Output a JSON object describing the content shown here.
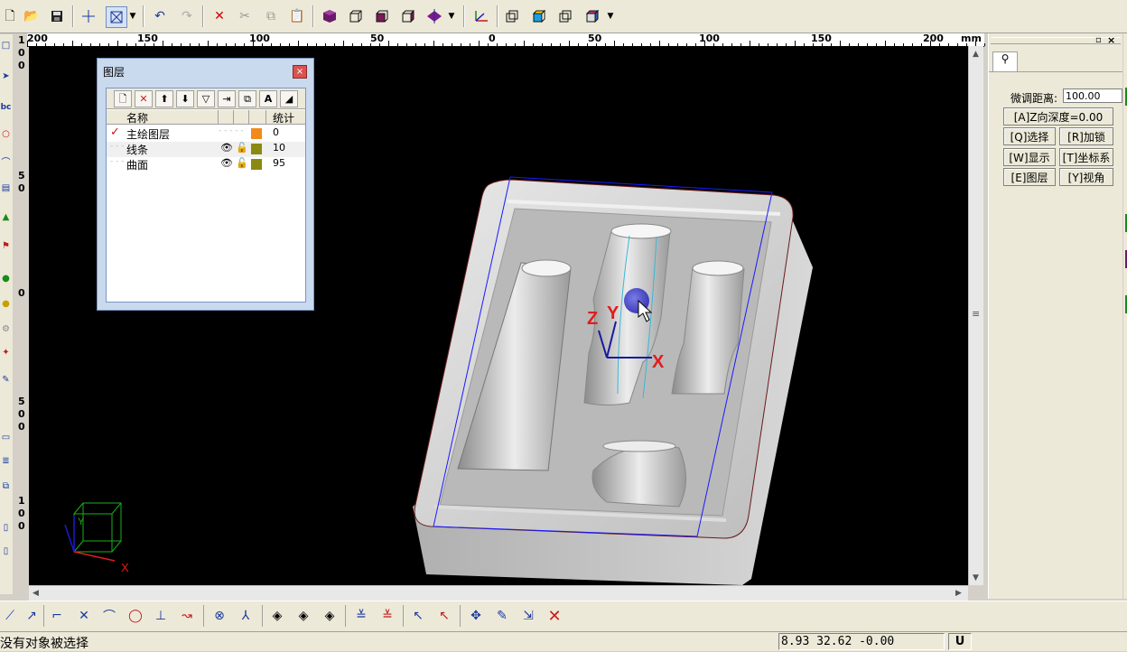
{
  "top_toolbar": {
    "icons": [
      "new-file-icon",
      "open-folder-icon",
      "save-icon",
      "crosshair-icon",
      "box-select-icon",
      "dropdown-arrow-icon",
      "undo-icon",
      "redo-icon",
      "delete-icon",
      "cut-icon",
      "copy-icon",
      "paste-icon",
      "shaded-cube-icon",
      "wire-cube-icon",
      "cube-front-icon",
      "cube-side-icon",
      "cube-iso-icon",
      "dropdown-arrow-icon",
      "axis-icon",
      "view-front-icon",
      "view-top-icon",
      "view-back-icon",
      "view-custom-icon",
      "dropdown-arrow-icon"
    ]
  },
  "ruler": {
    "labels": [
      "200",
      "150",
      "100",
      "50",
      "0",
      "50",
      "100",
      "150",
      "200"
    ],
    "unit": "mm"
  },
  "left_digits": [
    "1",
    "0",
    "0",
    "5",
    "0",
    "0",
    "5",
    "0",
    "0",
    "1",
    "0",
    "0"
  ],
  "layer_panel": {
    "title": "图层",
    "close_glyph": "×",
    "toolbar_icons": [
      "new-layer-icon",
      "delete-layer-icon",
      "move-up-icon",
      "move-down-icon",
      "filter-icon",
      "import-icon",
      "export-icon",
      "text-icon",
      "corner-icon"
    ],
    "col_name": "名称",
    "col_count": "统计",
    "rows": [
      {
        "name": "主绘图层",
        "count": "0",
        "color": "#f28a1a",
        "current": true
      },
      {
        "name": "线条",
        "count": "10",
        "color": "#8a8a12",
        "current": false
      },
      {
        "name": "曲面",
        "count": "95",
        "color": "#8a8a12",
        "current": false
      }
    ]
  },
  "viewport": {
    "axis_labels": {
      "z": "Z",
      "y": "Y",
      "x": "X"
    },
    "mini_axes": {
      "y": "Y",
      "x": "X"
    }
  },
  "right_panel": {
    "fine_tune_label": "微调距离:",
    "fine_tune_value": "100.00",
    "z_depth_button": "[A]Z向深度=0.00",
    "buttons": [
      [
        "[Q]选择",
        "[R]加锁"
      ],
      [
        "[W]显示",
        "[T]坐标系"
      ],
      [
        "[E]图层",
        "[Y]视角"
      ]
    ]
  },
  "bottom_toolbar": {
    "icons": [
      "line-icon",
      "polyline-icon",
      "fillet-icon",
      "trim-icon",
      "arc-icon",
      "circle-icon",
      "perpendicular-icon",
      "curve-icon",
      "point-icon",
      "corner-point-icon",
      "diamond-icon",
      "diamond-icon",
      "diamond-icon",
      "hatch-icon",
      "hatch-icon",
      "select-icon",
      "select-icon",
      "move-icon",
      "edit-icon",
      "transform-icon",
      "close-icon"
    ]
  },
  "status_bar": {
    "message": "没有对象被选择",
    "coords": "8.93 32.62 -0.00",
    "u_button": "U"
  },
  "colors": {
    "viewport_bg": "#000000",
    "part_surface": "#c8c8c8",
    "bbox": "#1a1aff",
    "axis_x": "#e21c1c",
    "axis_y": "#e21c1c",
    "axis_z": "#e21c1c",
    "cursor_dot": "#4646d2"
  }
}
